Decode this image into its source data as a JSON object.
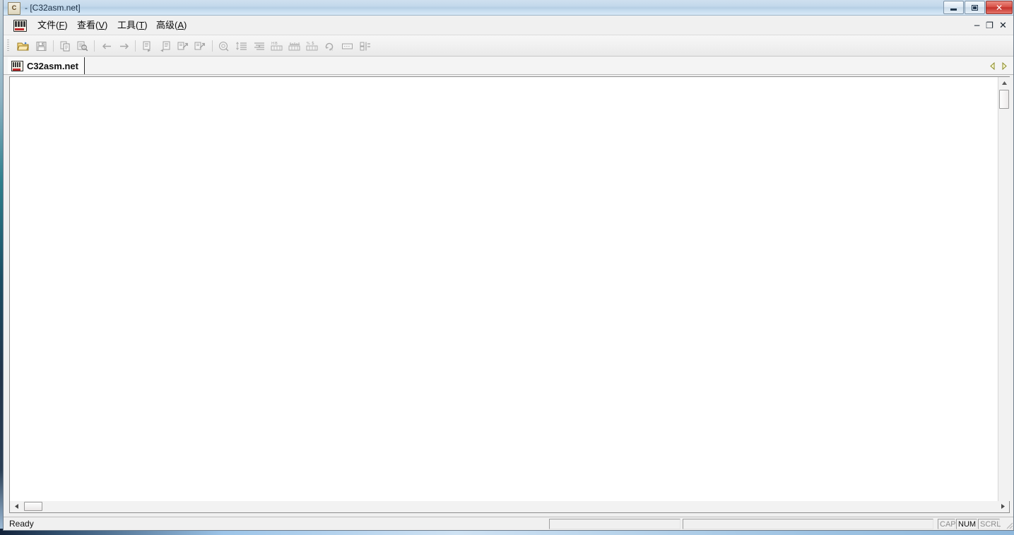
{
  "window": {
    "title": "- [C32asm.net]",
    "icon": "app-icon",
    "controls": {
      "minimize": "minimize-icon",
      "maximize": "restore-icon",
      "close": "close-icon"
    }
  },
  "menubar": {
    "items": [
      {
        "label": "文件(F)",
        "text": "文件(",
        "accel": "F",
        "tail": ")"
      },
      {
        "label": "查看(V)",
        "text": "查看(",
        "accel": "V",
        "tail": ")"
      },
      {
        "label": "工具(T)",
        "text": "工具(",
        "accel": "T",
        "tail": ")"
      },
      {
        "label": "高级(A)",
        "text": "高级(",
        "accel": "A",
        "tail": ")"
      }
    ],
    "mdi_controls": {
      "minimize": "−",
      "restore": "❐",
      "close": "✕"
    }
  },
  "toolbar": {
    "buttons": [
      {
        "name": "open-file-icon",
        "enabled": true
      },
      {
        "name": "save-file-icon",
        "enabled": false
      },
      {
        "name": "copy-icon",
        "enabled": false
      },
      {
        "name": "search-icon",
        "enabled": false
      },
      {
        "name": "back-arrow-icon",
        "enabled": false
      },
      {
        "name": "forward-arrow-icon",
        "enabled": false
      },
      {
        "name": "step-into-icon",
        "enabled": false
      },
      {
        "name": "step-out-icon",
        "enabled": false
      },
      {
        "name": "jump-to-icon",
        "enabled": false
      },
      {
        "name": "jump-back-icon",
        "enabled": false
      },
      {
        "name": "analyze-icon",
        "enabled": false
      },
      {
        "name": "sort-list-icon",
        "enabled": false
      },
      {
        "name": "align-list-icon",
        "enabled": false
      },
      {
        "name": "hex-table-icon",
        "enabled": false
      },
      {
        "name": "memory-map-icon",
        "enabled": false
      },
      {
        "name": "string-table-icon",
        "enabled": false
      },
      {
        "name": "loop-icon",
        "enabled": false
      },
      {
        "name": "comment-bar-icon",
        "enabled": false
      },
      {
        "name": "columns-icon",
        "enabled": false
      }
    ]
  },
  "tabs": {
    "items": [
      {
        "label": "C32asm.net",
        "icon": "document-icon",
        "active": true
      }
    ],
    "scroll_prev": "◁",
    "scroll_next": "▷"
  },
  "document": {
    "content": ""
  },
  "scrollbars": {
    "vertical": {
      "up": "▲",
      "down": "▼"
    },
    "horizontal": {
      "left": "◀",
      "right": "▶"
    }
  },
  "statusbar": {
    "message": "Ready",
    "panels": [
      "",
      ""
    ],
    "indicators": [
      {
        "label": "CAP",
        "active": false
      },
      {
        "label": "NUM",
        "active": true
      },
      {
        "label": "SCRL",
        "active": false
      }
    ]
  },
  "colors": {
    "titlebar": "#c3d8eb",
    "close_button": "#d9544a",
    "toolbar_bg": "#f0f0f0",
    "client_bg": "#ffffff",
    "tab_arrow": "#8a8a2a"
  }
}
